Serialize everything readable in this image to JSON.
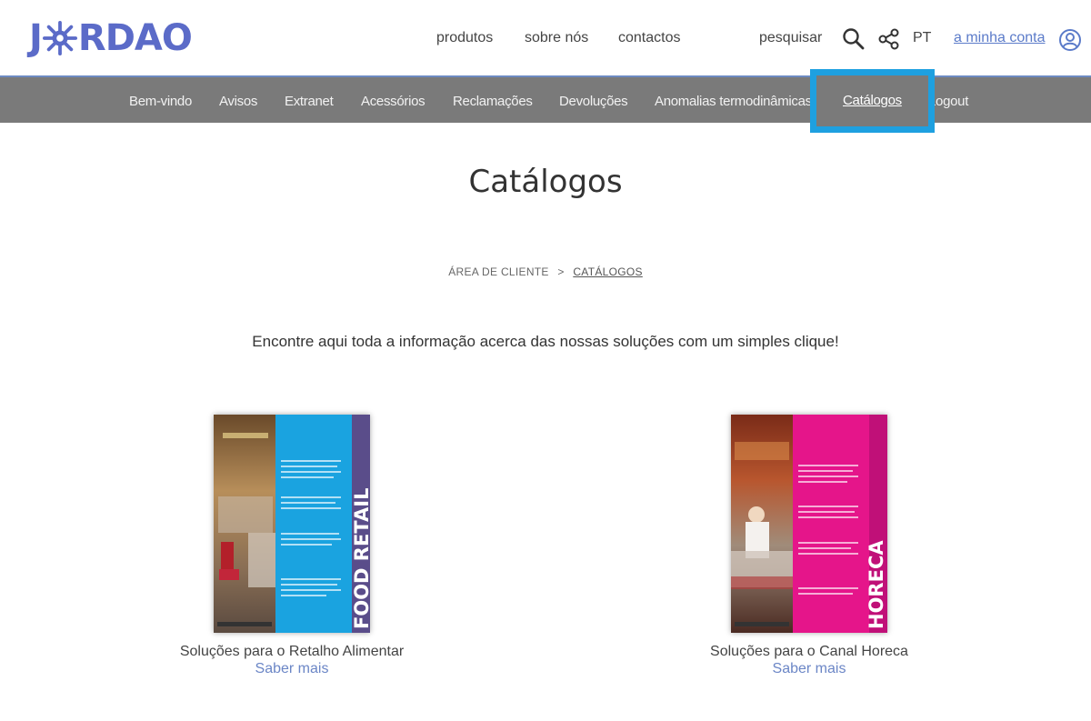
{
  "header": {
    "logo_text": "JØRDAO",
    "nav": {
      "produtos": "produtos",
      "sobre": "sobre nós",
      "contactos": "contactos",
      "pesquisar": "pesquisar",
      "language": "PT",
      "account": "a minha conta"
    },
    "icons": [
      "search-icon",
      "share-icon",
      "user-circle-icon"
    ]
  },
  "navbar": {
    "items": [
      "Bem-vindo",
      "Avisos",
      "Extranet",
      "Acessórios",
      "Reclamações",
      "Devoluções",
      "Anomalias termodinâmicas",
      "Catálogos",
      "Logout"
    ],
    "active": "Catálogos"
  },
  "page": {
    "title": "Catálogos",
    "breadcrumb": {
      "root": "ÁREA DE CLIENTE",
      "separator": ">",
      "current": "CATÁLOGOS"
    },
    "intro": "Encontre aqui toda a informação acerca das nossas soluções com um simples clique!"
  },
  "catalogs": [
    {
      "title": "Soluções para o Retalho Alimentar",
      "link": "Saber mais",
      "cover_label": "FOOD RETAIL",
      "cover_color": "#1aa3e0"
    },
    {
      "title": "Soluções para o Canal Horeca",
      "link": "Saber mais",
      "cover_label": "HORECA",
      "cover_color": "#e5158a"
    }
  ],
  "colors": {
    "brand": "#5b6bc8",
    "navbar": "#7a7a7a",
    "highlight": "#1ea0e0",
    "link": "#6b86c6"
  }
}
